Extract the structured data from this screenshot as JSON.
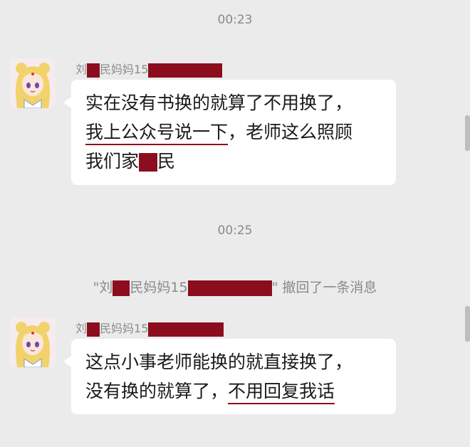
{
  "timestamps": [
    "00:23",
    "00:25"
  ],
  "messages": [
    {
      "sender_prefix": "刘",
      "sender_suffix": "民妈妈15",
      "line1": "实在没有书换的就算了不用换了，",
      "line2_underlined": "我上公众号说一下",
      "line2_rest": "，老师这么照顾",
      "line3_prefix": "我们家",
      "line3_suffix": "民"
    },
    {
      "sender_prefix": "刘",
      "sender_suffix": "民妈妈15",
      "line1": "这点小事老师能换的就直接换了，",
      "line2_start": "没有换的就算了，",
      "line2_underlined": "不用回复我话"
    }
  ],
  "recall_notice": {
    "open_quote": "\"刘",
    "middle": "民妈妈15",
    "close_quote_text": "\" 撤回了一条消息"
  },
  "colors": {
    "background": "#ebebeb",
    "bubble": "#ffffff",
    "redaction": "#8c0e1e",
    "meta_text": "#8a8a8a"
  }
}
